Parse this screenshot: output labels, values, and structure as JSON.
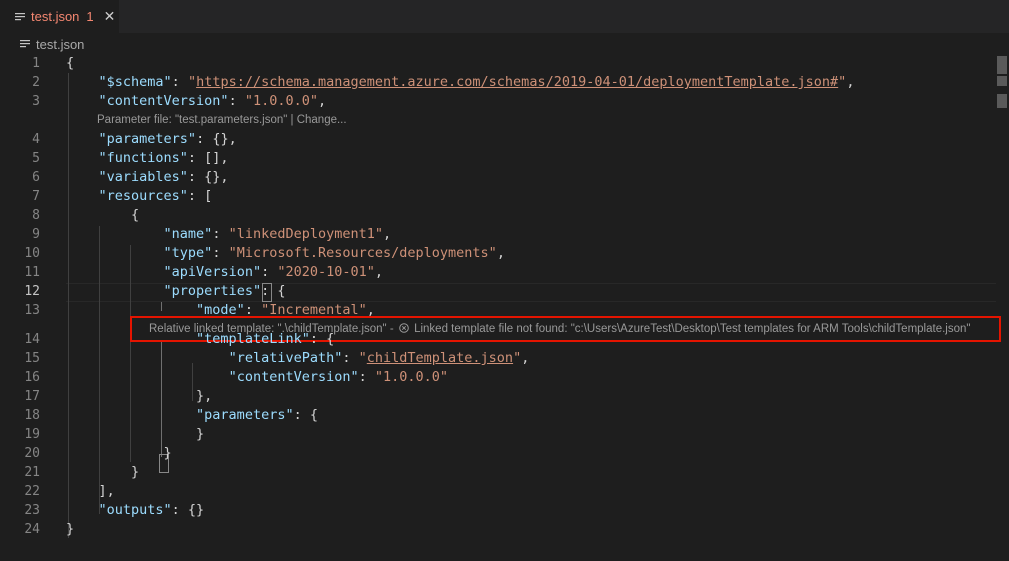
{
  "tab": {
    "filename": "test.json",
    "problem_count": "1",
    "close_glyph": "✕"
  },
  "breadcrumb": {
    "filename": "test.json"
  },
  "codelens": {
    "parameter_file": "Parameter file: \"test.parameters.json\" | Change...",
    "linked_prefix": "Relative linked template: \".\\childTemplate.json\" - ",
    "linked_error": "Linked template file not found: \"c:\\Users\\AzureTest\\Desktop\\Test templates for ARM Tools\\childTemplate.json\""
  },
  "lines": [
    {
      "n": "1",
      "tokens": [
        [
          "p",
          "{"
        ]
      ]
    },
    {
      "n": "2",
      "tokens": [
        [
          "p",
          "    "
        ],
        [
          "key",
          "\"$schema\""
        ],
        [
          "p",
          ": "
        ],
        [
          "str",
          "\""
        ],
        [
          "link",
          "https://schema.management.azure.com/schemas/2019-04-01/deploymentTemplate.json#"
        ],
        [
          "str",
          "\""
        ],
        [
          "p",
          ","
        ]
      ]
    },
    {
      "n": "3",
      "tokens": [
        [
          "p",
          "    "
        ],
        [
          "key",
          "\"contentVersion\""
        ],
        [
          "p",
          ": "
        ],
        [
          "str",
          "\"1.0.0.0\""
        ],
        [
          "p",
          ","
        ]
      ]
    },
    {
      "n": "4",
      "tokens": [
        [
          "p",
          "    "
        ],
        [
          "key",
          "\"parameters\""
        ],
        [
          "p",
          ": {},"
        ]
      ]
    },
    {
      "n": "5",
      "tokens": [
        [
          "p",
          "    "
        ],
        [
          "key",
          "\"functions\""
        ],
        [
          "p",
          ": [],"
        ]
      ]
    },
    {
      "n": "6",
      "tokens": [
        [
          "p",
          "    "
        ],
        [
          "key",
          "\"variables\""
        ],
        [
          "p",
          ": {},"
        ]
      ]
    },
    {
      "n": "7",
      "tokens": [
        [
          "p",
          "    "
        ],
        [
          "key",
          "\"resources\""
        ],
        [
          "p",
          ": ["
        ]
      ]
    },
    {
      "n": "8",
      "tokens": [
        [
          "p",
          "        {"
        ]
      ]
    },
    {
      "n": "9",
      "tokens": [
        [
          "p",
          "            "
        ],
        [
          "key",
          "\"name\""
        ],
        [
          "p",
          ": "
        ],
        [
          "str",
          "\"linkedDeployment1\""
        ],
        [
          "p",
          ","
        ]
      ]
    },
    {
      "n": "10",
      "tokens": [
        [
          "p",
          "            "
        ],
        [
          "key",
          "\"type\""
        ],
        [
          "p",
          ": "
        ],
        [
          "str",
          "\"Microsoft.Resources/deployments\""
        ],
        [
          "p",
          ","
        ]
      ]
    },
    {
      "n": "11",
      "tokens": [
        [
          "p",
          "            "
        ],
        [
          "key",
          "\"apiVersion\""
        ],
        [
          "p",
          ": "
        ],
        [
          "str",
          "\"2020-10-01\""
        ],
        [
          "p",
          ","
        ]
      ]
    },
    {
      "n": "12",
      "tokens": [
        [
          "p",
          "            "
        ],
        [
          "key",
          "\"properties\""
        ],
        [
          "p",
          ": {"
        ]
      ]
    },
    {
      "n": "13",
      "tokens": [
        [
          "p",
          "                "
        ],
        [
          "key",
          "\"mode\""
        ],
        [
          "p",
          ": "
        ],
        [
          "str",
          "\"Incremental\""
        ],
        [
          "p",
          ","
        ]
      ]
    },
    {
      "n": "14",
      "tokens": [
        [
          "p",
          "                "
        ],
        [
          "key",
          "\"templateLink\""
        ],
        [
          "p",
          ": {"
        ]
      ]
    },
    {
      "n": "15",
      "tokens": [
        [
          "p",
          "                    "
        ],
        [
          "key",
          "\"relativePath\""
        ],
        [
          "p",
          ": "
        ],
        [
          "str",
          "\""
        ],
        [
          "link",
          "childTemplate.json"
        ],
        [
          "str",
          "\""
        ],
        [
          "p",
          ","
        ]
      ]
    },
    {
      "n": "16",
      "tokens": [
        [
          "p",
          "                    "
        ],
        [
          "key",
          "\"contentVersion\""
        ],
        [
          "p",
          ": "
        ],
        [
          "str",
          "\"1.0.0.0\""
        ]
      ]
    },
    {
      "n": "17",
      "tokens": [
        [
          "p",
          "                },"
        ]
      ]
    },
    {
      "n": "18",
      "tokens": [
        [
          "p",
          "                "
        ],
        [
          "key",
          "\"parameters\""
        ],
        [
          "p",
          ": {"
        ]
      ]
    },
    {
      "n": "19",
      "tokens": [
        [
          "p",
          "                }"
        ]
      ]
    },
    {
      "n": "20",
      "tokens": [
        [
          "p",
          "            }"
        ]
      ]
    },
    {
      "n": "21",
      "tokens": [
        [
          "p",
          "        }"
        ]
      ]
    },
    {
      "n": "22",
      "tokens": [
        [
          "p",
          "    ],"
        ]
      ]
    },
    {
      "n": "23",
      "tokens": [
        [
          "p",
          "    "
        ],
        [
          "key",
          "\"outputs\""
        ],
        [
          "p",
          ": {}"
        ]
      ]
    },
    {
      "n": "24",
      "tokens": [
        [
          "p",
          "}"
        ]
      ]
    }
  ],
  "active_line": "12",
  "colors": {
    "key": "#9cdcfe",
    "string": "#ce9178",
    "error_tab": "#f48771",
    "highlight_border": "#e51400"
  }
}
